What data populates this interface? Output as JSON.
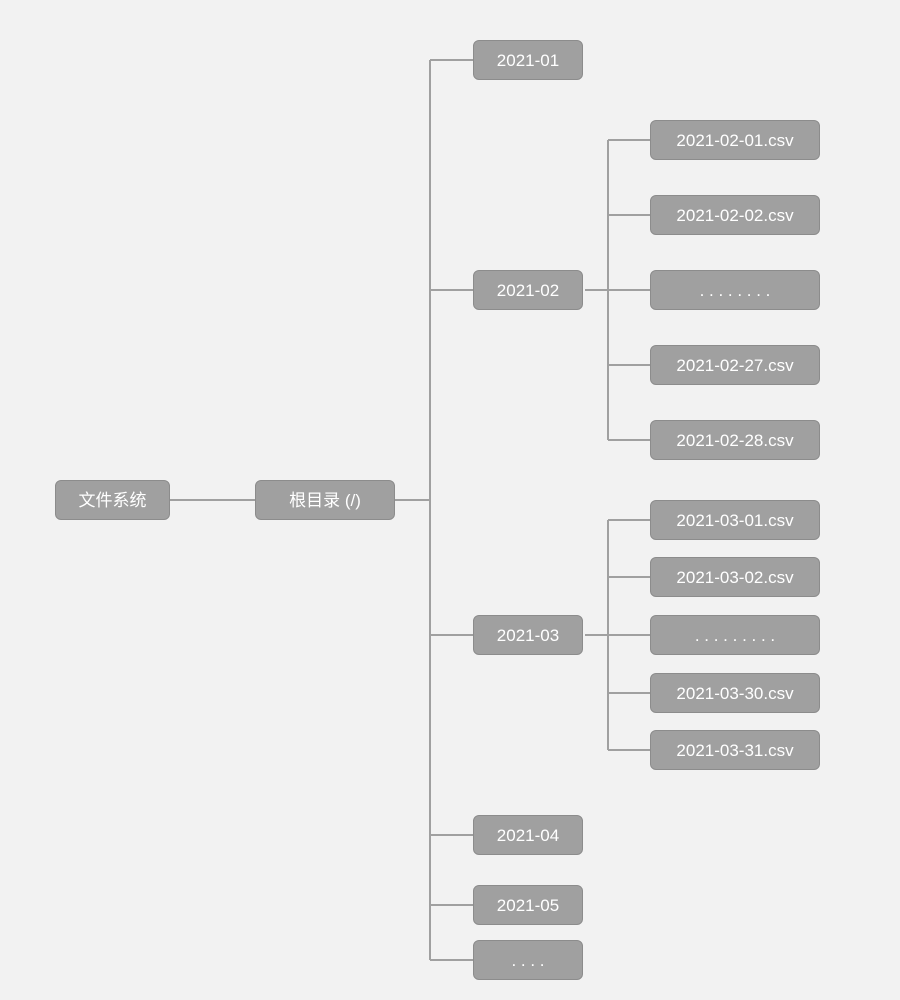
{
  "root": {
    "label": "文件系统"
  },
  "level1": {
    "label": "根目录 (/)"
  },
  "months": {
    "m01": "2021-01",
    "m02": "2021-02",
    "m03": "2021-03",
    "m04": "2021-04",
    "m05": "2021-05",
    "m06": ". . . ."
  },
  "m02_files": {
    "f1": "2021-02-01.csv",
    "f2": "2021-02-02.csv",
    "f3": ". . . . . . . .",
    "f4": "2021-02-27.csv",
    "f5": "2021-02-28.csv"
  },
  "m03_files": {
    "f1": "2021-03-01.csv",
    "f2": "2021-03-02.csv",
    "f3": ". . . . . . . . .",
    "f4": "2021-03-30.csv",
    "f5": "2021-03-31.csv"
  }
}
